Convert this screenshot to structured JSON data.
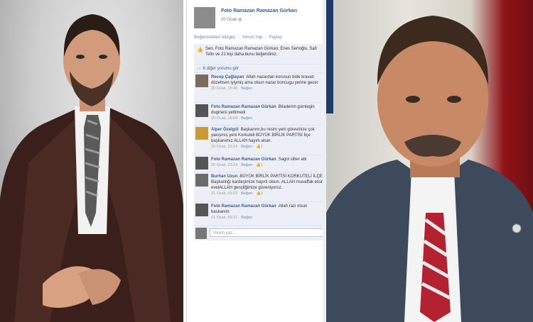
{
  "post": {
    "author": "Foto Ramazan Ramazan Gürkan",
    "date": "20 Ocak"
  },
  "actions": [
    "Beğenmekten Vazgeç",
    "·",
    "Yorum Yap",
    "·",
    "Paylaş"
  ],
  "likes_text": "Sen, Foto Ramazan Ramazan Gürkan, Enes Sertoğlu, Safi Telin ve 21 kişi daha bunu beğendiniz.",
  "more_comments": "6 diğer yorumu gör",
  "comments": [
    {
      "name": "Recep Çağlayan",
      "text": "Allah nazardan korusun bide kravatı düzeltsen iyiymiş ama olsun nazar boncugu yerine gecer",
      "meta": "20 Ocak, 15:45",
      "like": "Beğen",
      "likes": ""
    },
    {
      "name": "Foto Ramazan Ramazan Gürkan",
      "text": "Biladerim gomlegin dugmesi yettimedi",
      "meta": "20 Ocak, 16:04",
      "like": "Beğen",
      "likes": ""
    },
    {
      "name": "Alper Özelgül",
      "text": "Başkanım,bu resim yeni görevinize çok yakışmış yeni Korkuteli BÜYÜK BİRLİK PARTİSİ İlçe başkanımız ALLAH hayırlı etsin.",
      "meta": "20 Ocak, 23:16",
      "like": "Beğen",
      "likes": "1"
    },
    {
      "name": "Foto Ramazan Ramazan Gürkan",
      "text": "Sagol siber abi",
      "meta": "20 Ocak, 23:24",
      "like": "Beğen",
      "likes": "1"
    },
    {
      "name": "Burhan Uzun",
      "text": "BÜYÜK BİRLİK PARTİSİ KORKUTELİ İLÇE Başkanlığı kardeşimize hayırlı olsun..ALLAH muvaffak etsin evelALLAH gençliğimize güveniyoruz.",
      "meta": "21 Ocak, 01:22",
      "like": "Beğen",
      "likes": "2"
    },
    {
      "name": "Foto Ramazan Ramazan Gürkan",
      "text": "Allah razi olsun baskanim",
      "meta": "21 Ocak, 06:21",
      "like": "Beğen",
      "likes": ""
    }
  ],
  "write_placeholder": "Yorum yaz..."
}
